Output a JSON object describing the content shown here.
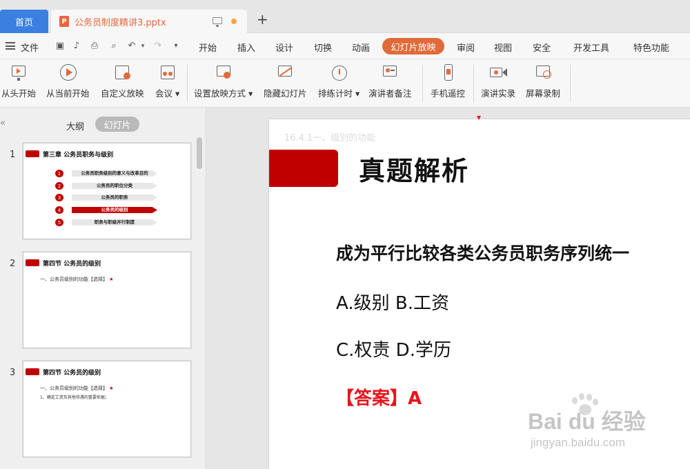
{
  "tabs": {
    "home_label": "首页",
    "doc_label": "公务员制度精讲3.pptx",
    "doc_icon_letter": "P"
  },
  "menu": {
    "file_label": "文件",
    "items": [
      "开始",
      "插入",
      "设计",
      "切换",
      "动画",
      "幻灯片放映",
      "审阅",
      "视图",
      "安全",
      "开发工具",
      "特色功能"
    ],
    "active": "幻灯片放映"
  },
  "ribbon": {
    "buttons": [
      "从头开始",
      "从当前开始",
      "自定义放映",
      "会议",
      "设置放映方式",
      "隐藏幻灯片",
      "排练计时",
      "演讲者备注",
      "手机遥控",
      "演讲实录",
      "屏幕录制"
    ]
  },
  "pane": {
    "collapse": "«",
    "tab_outline": "大纲",
    "tab_slides": "幻灯片"
  },
  "thumbnails": [
    {
      "num": "1",
      "title": "第三章  公务员职务与级别",
      "toc": [
        {
          "n": "1",
          "text": "公务员职务级别的意义与改革目的"
        },
        {
          "n": "2",
          "text": "公务员的职位分类"
        },
        {
          "n": "3",
          "text": "公务员的职务"
        },
        {
          "n": "4",
          "text": "公务员的级别"
        },
        {
          "n": "5",
          "text": "职务与职级并行制度"
        }
      ]
    },
    {
      "num": "2",
      "title": "第四节  公务员的级别",
      "line1": "一、公务员级别的功能【选择】",
      "star": "★"
    },
    {
      "num": "3",
      "title": "第四节  公务员的级别",
      "line1": "一、公务员级别的功能【选择】",
      "star": "★",
      "line2": "1、确定工资及其他待遇的重要依据；"
    }
  ],
  "slide": {
    "top_faded": "16.4.1一、级别的功能",
    "title": "真题解析",
    "question": "成为平行比较各类公务员职务序列统一",
    "option1": "A.级别 B.工资",
    "option2": "C.权责 D.学历",
    "answer": "【答案】A"
  },
  "watermark": {
    "logo": "Bai   du 经验",
    "url": "jingyan.baidu.com"
  },
  "colors": {
    "accent_orange": "#e06b3a",
    "home_tab_blue": "#3b7fe0",
    "slide_red": "#c00000",
    "answer_red": "#e8141c"
  }
}
